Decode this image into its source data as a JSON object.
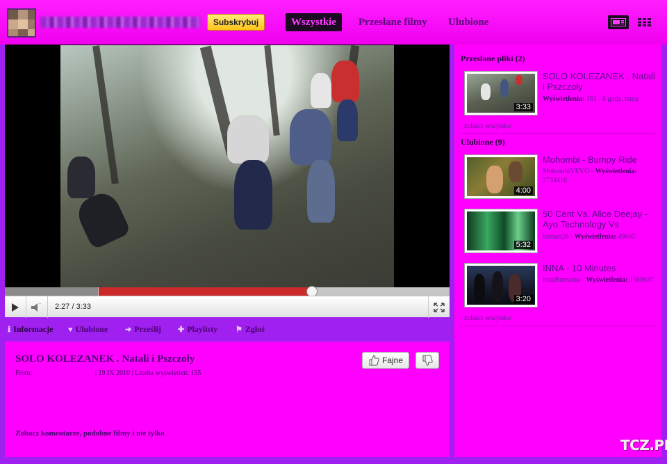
{
  "header": {
    "subscribe_label": "Subskrybuj",
    "nav_tabs": [
      {
        "label": "Wszystkie",
        "active": true
      },
      {
        "label": "Przesłane filmy",
        "active": false
      },
      {
        "label": "Ulubione",
        "active": false
      }
    ],
    "view_modes": [
      "player-view-icon",
      "grid-view-icon"
    ]
  },
  "player": {
    "current_time": "2:27",
    "duration": "3:33",
    "time_display": "2:27 / 3:33",
    "played_fraction": 0.69,
    "loaded_fraction": 0.21,
    "icons": [
      "play-icon",
      "volume-icon",
      "fullscreen-icon"
    ]
  },
  "info_tabs": [
    {
      "label": "Informacje",
      "icon": "info-icon",
      "active": true
    },
    {
      "label": "Ulubione",
      "icon": "heart-icon",
      "active": false
    },
    {
      "label": "Prześlij",
      "icon": "share-arrow-icon",
      "active": false
    },
    {
      "label": "Playlisty",
      "icon": "plus-icon",
      "active": false
    },
    {
      "label": "Zgłoś",
      "icon": "flag-icon",
      "active": false
    }
  ],
  "video_info": {
    "title": "SOLO KOLEZANEK . Natali i Pszczoły",
    "from_label": "From:",
    "date": "| 19 IX 2010",
    "views": "| Liczba wyświetleń: 155",
    "like_label": "Fajne",
    "more_link": "Zobacz komentarze, podobne filmy i nie tylko"
  },
  "sidebar": {
    "uploads": {
      "heading": "Przesłane pliki (2)",
      "items": [
        {
          "title": "SOLO KOLEZANEK . Natali i Pszczoły",
          "meta_label": "Wyświetlenia:",
          "meta_value": "161 - 8 godz. temu",
          "duration": "3:33"
        }
      ],
      "see_all": "zobacz wszystko"
    },
    "favorites": {
      "heading": "Ulubione (9)",
      "items": [
        {
          "title": "Mohombi - Bumpy Ride",
          "author": "MohombiVEVO",
          "meta_label": "Wyświetlenia:",
          "meta_value": "2734416",
          "duration": "4:00"
        },
        {
          "title": "50 Cent Vs. Alice Deejay - Ayo Technology Vs",
          "author": "bbman28",
          "meta_label": "Wyświetlenia:",
          "meta_value": "49605",
          "duration": "5:32"
        },
        {
          "title": "INNA - 10 Minutes",
          "author": "InnaRomania",
          "meta_label": "Wyświetlenia:",
          "meta_value": "1560637",
          "duration": "3:20"
        }
      ],
      "see_all": "zobacz wszystko"
    }
  },
  "watermark": "TCZ.PL",
  "colors": {
    "page_bg": "#a020f0",
    "panel_bg": "#ff00ff",
    "text": "#4b0073",
    "progress_played": "#cc2a2a",
    "subscribe_bg": "#ffc21a"
  }
}
